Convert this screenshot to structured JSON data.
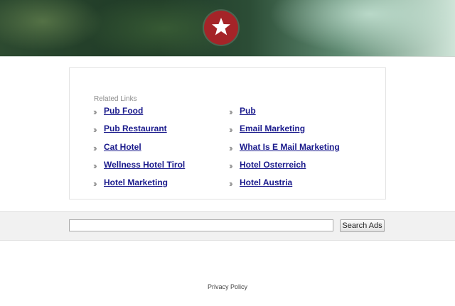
{
  "header": {
    "logo_icon": "star-icon",
    "logo_color": "#a52428"
  },
  "related": {
    "title": "Related Links",
    "left": [
      "Pub Food",
      "Pub Restaurant",
      "Cat Hotel",
      "Wellness Hotel Tirol",
      "Hotel Marketing"
    ],
    "right": [
      "Pub",
      "Email Marketing",
      "What Is E Mail Marketing",
      "Hotel Osterreich",
      "Hotel Austria"
    ]
  },
  "search": {
    "value": "",
    "button_label": "Search Ads"
  },
  "footer": {
    "privacy_label": "Privacy Policy"
  }
}
